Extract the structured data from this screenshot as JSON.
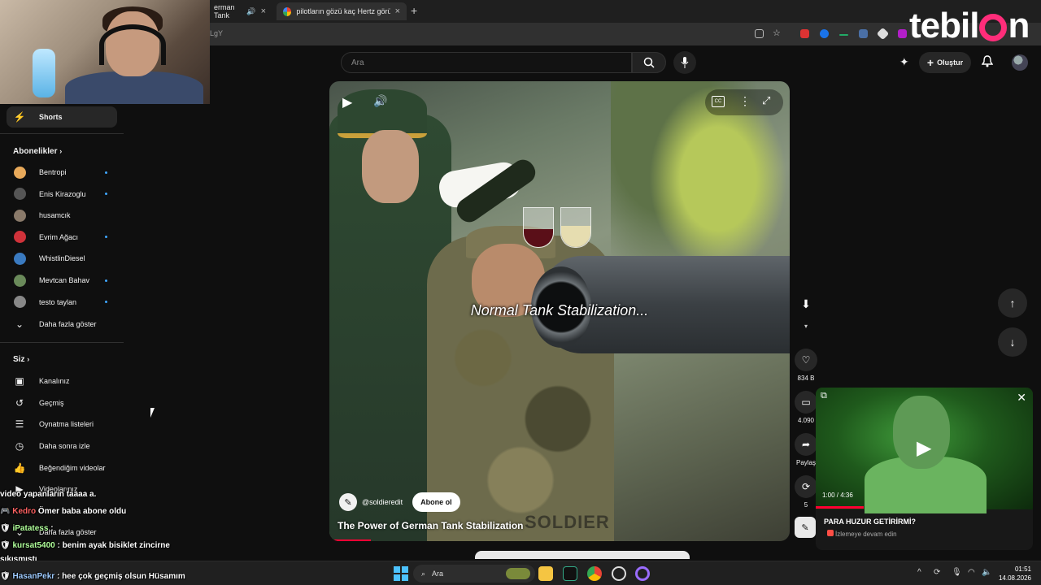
{
  "browser": {
    "tab1_label": "erman Tank",
    "tab2_label": "pilotların gözü kaç Hertz görüy",
    "url_fragment": "LgY"
  },
  "brand": {
    "before": "tebil",
    "after": "n"
  },
  "header": {
    "search_placeholder": "Ara",
    "create_label": "Oluştur"
  },
  "sidebar": {
    "shorts_label": "Shorts",
    "subscriptions_title": "Abonelikler",
    "channels": [
      {
        "name": "Bentropi",
        "color": "#e8a95a",
        "new": true
      },
      {
        "name": "Enis Kirazoglu",
        "color": "#555555",
        "new": true
      },
      {
        "name": "husamcık",
        "color": "#8a7a6a",
        "new": false
      },
      {
        "name": "Evrim Ağacı",
        "color": "#d0323a",
        "new": true
      },
      {
        "name": "WhistlinDiesel",
        "color": "#3a7ac0",
        "new": false
      },
      {
        "name": "Mevtcan Bahav",
        "color": "#6a8a5a",
        "new": true
      },
      {
        "name": "testo taylan",
        "color": "#888888",
        "new": true
      }
    ],
    "show_more": "Daha fazla göster",
    "you_title": "Siz",
    "you_items": [
      "Kanalınız",
      "Geçmiş",
      "Oynatma listeleri",
      "Daha sonra izle",
      "Beğendiğim videolar",
      "Videolarınız"
    ],
    "show_more_2": "Daha fazla göster"
  },
  "chat": [
    {
      "user": "",
      "text": "video yapanların taaaa a."
    },
    {
      "user": "Kedro",
      "text": "Ömer baba abone oldu"
    },
    {
      "user": "iPatatess",
      "text": ":"
    },
    {
      "user": "kursat5400",
      "text": ": benim ayak bisiklet zincirne"
    },
    {
      "user": "",
      "text": "sıkışmıştı"
    },
    {
      "user": "HasanPekr",
      "text": ": hee çok geçmiş olsun Hüsamım"
    }
  ],
  "video": {
    "caption": "Normal Tank Stabilization...",
    "channel_handle": "@soldieredit",
    "subscribe_label": "Abone ol",
    "title": "The Power of German Tank Stabilization",
    "watermark": "SOLDIER",
    "progress": 0.09
  },
  "actions": {
    "likes": "834 B",
    "comments": "4.090",
    "share": "Paylaş",
    "remix_count": "5"
  },
  "miniplayer": {
    "time": "1:00 / 4:36",
    "title": "PARA HUZUR GETİRİRMİ?",
    "subtitle": "İzlemeye devam edin",
    "progress": 0.22
  },
  "taskbar": {
    "search_label": "Ara",
    "time": "01:51",
    "date": "14.08.2026"
  },
  "icons": {
    "play": "play-icon",
    "volume": "volume-icon",
    "cc": "captions-icon",
    "more": "more-icon",
    "fullscreen": "fullscreen-icon",
    "like": "like-icon",
    "comment": "comment-icon",
    "share": "share-icon",
    "remix": "remix-icon",
    "download": "download-icon"
  }
}
